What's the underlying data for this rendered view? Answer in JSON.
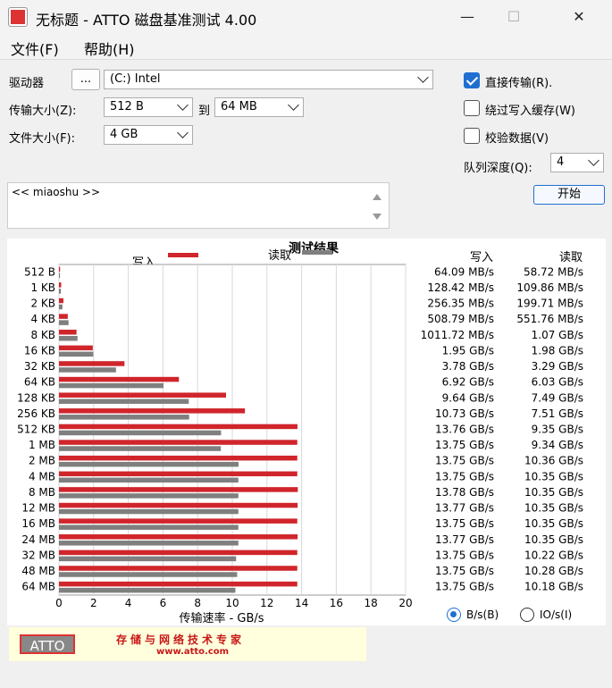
{
  "window": {
    "title": "无标题 - ATTO 磁盘基准测试 4.00",
    "minimize": "—",
    "maximize": "☐",
    "close": "✕"
  },
  "menu": {
    "file": "文件(F)",
    "help": "帮助(H)"
  },
  "controls": {
    "drive_label": "驱动器",
    "browse_label": "...",
    "drive_value": "(C:) Intel",
    "transfer_size_label": "传输大小(Z):",
    "transfer_from": "512 B",
    "to_label": "到",
    "transfer_to": "64 MB",
    "file_size_label": "文件大小(F):",
    "file_size": "4 GB",
    "direct_io_label": "直接传输(R).",
    "direct_io_checked": true,
    "bypass_write_cache_label": "绕过写入缓存(W)",
    "bypass_write_cache_checked": false,
    "verify_data_label": "校验数据(V)",
    "verify_data_checked": false,
    "queue_depth_label": "队列深度(Q):",
    "queue_depth": "4",
    "start_label": "开始",
    "description": "<< miaoshu >>"
  },
  "results": {
    "title": "测试结果",
    "write_header": "写入",
    "read_header": "读取",
    "unit_bytes_label": "B/s(B)",
    "unit_io_label": "IO/s(I)",
    "unit_selected": "B/s"
  },
  "chart_data": {
    "type": "bar",
    "orientation": "horizontal",
    "title": "测试结果",
    "xlabel": "传输速率 - GB/s",
    "xlim": [
      0,
      20
    ],
    "xticks": [
      0,
      2,
      4,
      6,
      8,
      10,
      12,
      14,
      16,
      18,
      20
    ],
    "grid": true,
    "categories": [
      "512 B",
      "1 KB",
      "2 KB",
      "4 KB",
      "8 KB",
      "16 KB",
      "32 KB",
      "64 KB",
      "128 KB",
      "256 KB",
      "512 KB",
      "1 MB",
      "2 MB",
      "4 MB",
      "8 MB",
      "12 MB",
      "16 MB",
      "24 MB",
      "32 MB",
      "48 MB",
      "64 MB"
    ],
    "series": [
      {
        "name": "写入",
        "color": "#d0252b",
        "values": [
          0.06409,
          0.12842,
          0.25635,
          0.50879,
          1.01172,
          1.95,
          3.78,
          6.92,
          9.64,
          10.73,
          13.76,
          13.75,
          13.75,
          13.75,
          13.78,
          13.77,
          13.75,
          13.77,
          13.75,
          13.75,
          13.75
        ],
        "labels": [
          "64.09 MB/s",
          "128.42 MB/s",
          "256.35 MB/s",
          "508.79 MB/s",
          "1011.72 MB/s",
          "1.95 GB/s",
          "3.78 GB/s",
          "6.92 GB/s",
          "9.64 GB/s",
          "10.73 GB/s",
          "13.76 GB/s",
          "13.75 GB/s",
          "13.75 GB/s",
          "13.75 GB/s",
          "13.78 GB/s",
          "13.77 GB/s",
          "13.75 GB/s",
          "13.77 GB/s",
          "13.75 GB/s",
          "13.75 GB/s",
          "13.75 GB/s"
        ]
      },
      {
        "name": "读取",
        "color": "#7f7f7f",
        "values": [
          0.05872,
          0.10986,
          0.19971,
          0.55176,
          1.07,
          1.98,
          3.29,
          6.03,
          7.49,
          7.51,
          9.35,
          9.34,
          10.36,
          10.35,
          10.35,
          10.35,
          10.35,
          10.35,
          10.22,
          10.28,
          10.18
        ],
        "labels": [
          "58.72 MB/s",
          "109.86 MB/s",
          "199.71 MB/s",
          "551.76 MB/s",
          "1.07 GB/s",
          "1.98 GB/s",
          "3.29 GB/s",
          "6.03 GB/s",
          "7.49 GB/s",
          "7.51 GB/s",
          "9.35 GB/s",
          "9.34 GB/s",
          "10.36 GB/s",
          "10.35 GB/s",
          "10.35 GB/s",
          "10.35 GB/s",
          "10.35 GB/s",
          "10.35 GB/s",
          "10.22 GB/s",
          "10.28 GB/s",
          "10.18 GB/s"
        ]
      }
    ]
  },
  "banner": {
    "logo": "ATTO",
    "slogan": "存储与网络技术专家",
    "url": "www.atto.com"
  }
}
